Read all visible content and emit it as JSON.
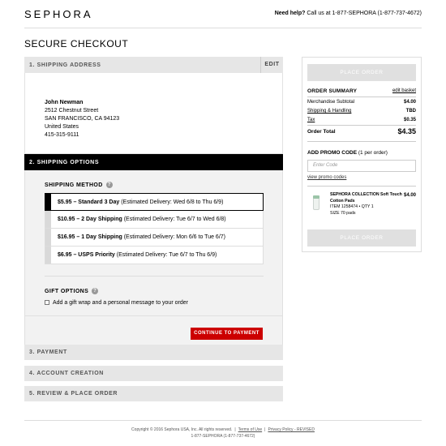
{
  "header": {
    "logo": "SEPHORA",
    "help_bold": "Need help?",
    "help_text": " Call us at 1-877-SEPHORA (1-877-737-4672)"
  },
  "page_title": "SECURE CHECKOUT",
  "shipping_address": {
    "title": "1. SHIPPING ADDRESS",
    "edit_label": "EDIT",
    "name": "John Newman",
    "street": "2512 Chestnut Street",
    "city": "SAN FRANCISCO, CA 94123",
    "country": "United States",
    "phone": "415-315-9111"
  },
  "shipping_options": {
    "title": "2. SHIPPING OPTIONS",
    "method_title": "SHIPPING METHOD",
    "options": [
      {
        "bold": "$5.95 – Standard 3 Day",
        "rest": " (Estimated Delivery: Wed 6/8 to Thu 6/9)"
      },
      {
        "bold": "$10.95 – 2 Day Shipping",
        "rest": " (Estimated Delivery: Tue 6/7 to Wed 6/8)"
      },
      {
        "bold": "$16.95 – 1 Day Shipping",
        "rest": " (Estimated Delivery: Mon 6/6 to Tue 6/7)"
      },
      {
        "bold": "$6.95 – USPS Priority",
        "rest": " (Estimated Delivery: Tue 6/7 to Thu 6/9)"
      }
    ],
    "selected_index": 0,
    "gift_title": "GIFT OPTIONS",
    "gift_label": "Add a gift wrap and a personal message to your order",
    "continue_label": "CONTINUE TO PAYMENT"
  },
  "steps": {
    "payment": "3. PAYMENT",
    "account": "4. ACCOUNT CREATION",
    "review": "5. REVIEW & PLACE ORDER"
  },
  "summary": {
    "place_order_label": "PLACE ORDER",
    "title": "ORDER SUMMARY",
    "edit_basket": "edit basket",
    "rows": [
      {
        "label": "Merchandise Subtotal",
        "value": "$4.00"
      },
      {
        "label": "Shipping & Handling",
        "value": "TBD"
      },
      {
        "label": "Tax",
        "value": "$0.35"
      }
    ],
    "total_label": "Order Total",
    "total_value": "$4.35",
    "promo_title": "ADD PROMO CODE",
    "promo_note": " (1 per order)",
    "promo_placeholder": "Enter Code",
    "promo_link": "view promo codes",
    "item": {
      "name": "SEPHORA COLLECTION Soft Touch Cotton Pads",
      "item_line": "ITEM 1258474 • QTY 1",
      "size": "SIZE 70 pads",
      "price": "$4.00"
    }
  },
  "footer": {
    "copyright": "Copyright © 2016 Sephora USA, Inc. All rights reserved.",
    "terms": "Terms of Use",
    "privacy": "Privacy Policy - REVISED",
    "phone": "1-877-SEPHORA (1-877-737-4672)"
  }
}
